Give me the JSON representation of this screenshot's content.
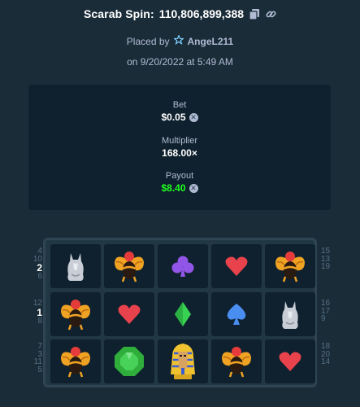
{
  "header": {
    "title": "Scarab Spin:",
    "bet_id": "110,806,899,388",
    "copy_icon": "copy-icon",
    "link_icon": "link-icon"
  },
  "placed": {
    "prefix": "Placed by",
    "user_icon": "star-badge-icon",
    "username": "AngeL211",
    "date": "on 9/20/2022 at 5:49 AM"
  },
  "stats": {
    "bet_label": "Bet",
    "bet_value": "$0.05",
    "multiplier_label": "Multiplier",
    "multiplier_value": "168.00×",
    "payout_label": "Payout",
    "payout_value": "$8.40",
    "currency_icon": "currency-coin-icon",
    "payout_color": "#1fff20"
  },
  "paylines": {
    "left": [
      [
        "4",
        "10",
        "2",
        "6"
      ],
      [
        "12",
        "1",
        "8"
      ],
      [
        "7",
        "3",
        "11",
        "5"
      ]
    ],
    "right": [
      [
        "15",
        "13",
        "19"
      ],
      [
        "16",
        "17",
        "9"
      ],
      [
        "18",
        "20",
        "14"
      ]
    ],
    "highlight_left": [
      "2",
      "1"
    ]
  },
  "reels": [
    [
      "cat-statue",
      "scarab",
      "scarab"
    ],
    [
      "scarab",
      "heart",
      "emerald"
    ],
    [
      "club",
      "diamond",
      "pharaoh"
    ],
    [
      "heart",
      "spade",
      "scarab"
    ],
    [
      "scarab",
      "cat-statue",
      "heart"
    ]
  ],
  "colors": {
    "background": "#1a2c38",
    "panel": "#0f212e",
    "frame": "#2f4553",
    "muted_text": "#b1bad3"
  }
}
